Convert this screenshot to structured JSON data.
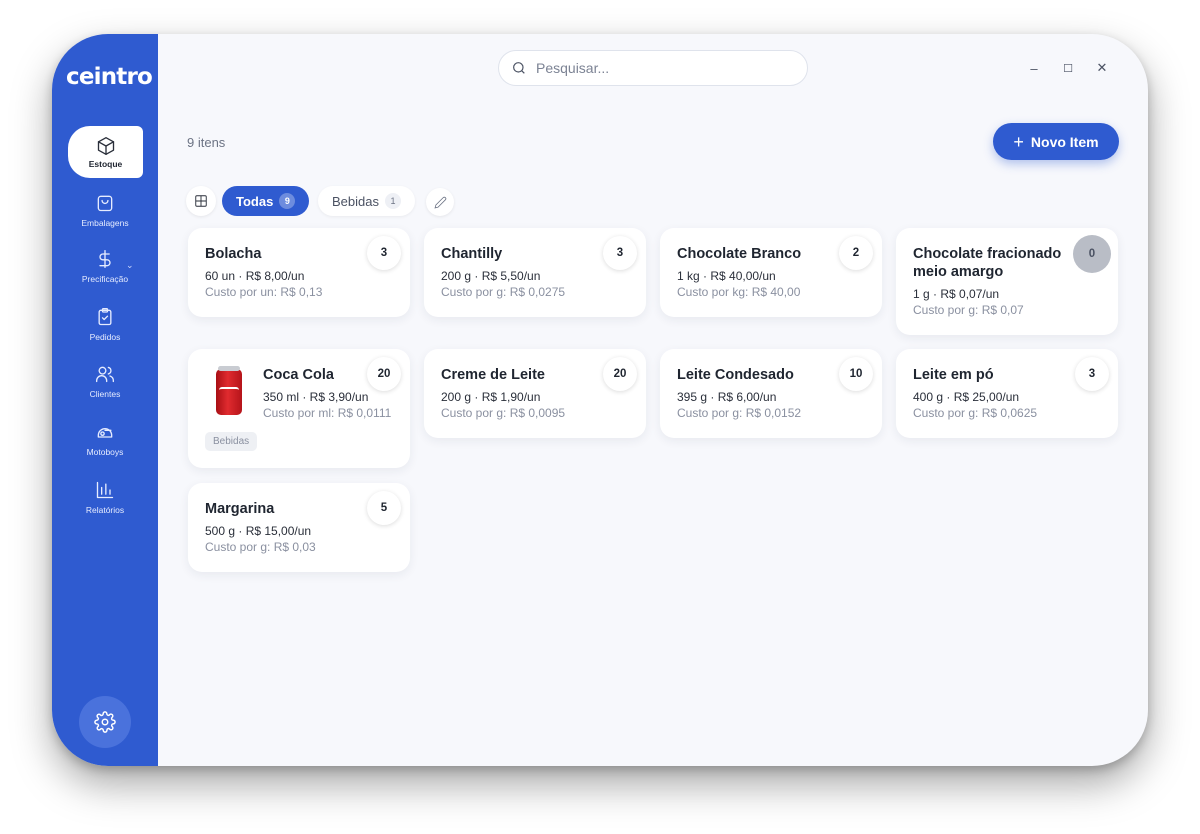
{
  "app": {
    "logo": "ceintro"
  },
  "sidebar": {
    "items": [
      {
        "label": "Estoque",
        "icon": "box-icon"
      },
      {
        "label": "Embalagens",
        "icon": "bag-icon"
      },
      {
        "label": "Precificação",
        "icon": "dollar-icon"
      },
      {
        "label": "Pedidos",
        "icon": "clipboard-icon"
      },
      {
        "label": "Clientes",
        "icon": "users-icon"
      },
      {
        "label": "Motoboys",
        "icon": "helmet-icon"
      },
      {
        "label": "Relatórios",
        "icon": "bar-chart-icon"
      }
    ],
    "caret": "⌄"
  },
  "search": {
    "placeholder": "Pesquisar..."
  },
  "window_controls": {
    "minimize": "–",
    "maximize": "☐",
    "close": "✕"
  },
  "header": {
    "count": "9 itens",
    "new_item": "Novo Item",
    "new_item_icon": "+"
  },
  "filters": {
    "all": {
      "label": "Todas",
      "count": "9"
    },
    "bebidas": {
      "label": "Bebidas",
      "count": "1"
    }
  },
  "items": [
    {
      "name": "Bolacha",
      "line1": "60 un · R$ 8,00/un",
      "line2": "Custo por un: R$ 0,13",
      "qty": "3"
    },
    {
      "name": "Chantilly",
      "line1": "200 g · R$ 5,50/un",
      "line2": "Custo por g: R$ 0,0275",
      "qty": "3"
    },
    {
      "name": "Chocolate Branco",
      "line1": "1 kg · R$ 40,00/un",
      "line2": "Custo por kg: R$ 40,00",
      "qty": "2"
    },
    {
      "name": "Chocolate fracionado meio amargo",
      "line1": "1 g · R$ 0,07/un",
      "line2": "Custo por g: R$ 0,07",
      "qty": "0"
    },
    {
      "name": "Coca Cola",
      "line1": "350 ml · R$ 3,90/un",
      "line2": "Custo por ml: R$ 0,0111",
      "qty": "20",
      "tag": "Bebidas"
    },
    {
      "name": "Creme de Leite",
      "line1": "200 g · R$ 1,90/un",
      "line2": "Custo por g: R$ 0,0095",
      "qty": "20"
    },
    {
      "name": "Leite Condesado",
      "line1": "395 g · R$ 6,00/un",
      "line2": "Custo por g: R$ 0,0152",
      "qty": "10"
    },
    {
      "name": "Leite em pó",
      "line1": "400 g · R$ 25,00/un",
      "line2": "Custo por g: R$ 0,0625",
      "qty": "3"
    },
    {
      "name": "Margarina",
      "line1": "500 g · R$ 15,00/un",
      "line2": "Custo por g: R$ 0,03",
      "qty": "5"
    }
  ],
  "colors": {
    "accent": "#2f5bd0",
    "background": "#f7f8fc",
    "zero_badge": "#b9bdc6"
  }
}
